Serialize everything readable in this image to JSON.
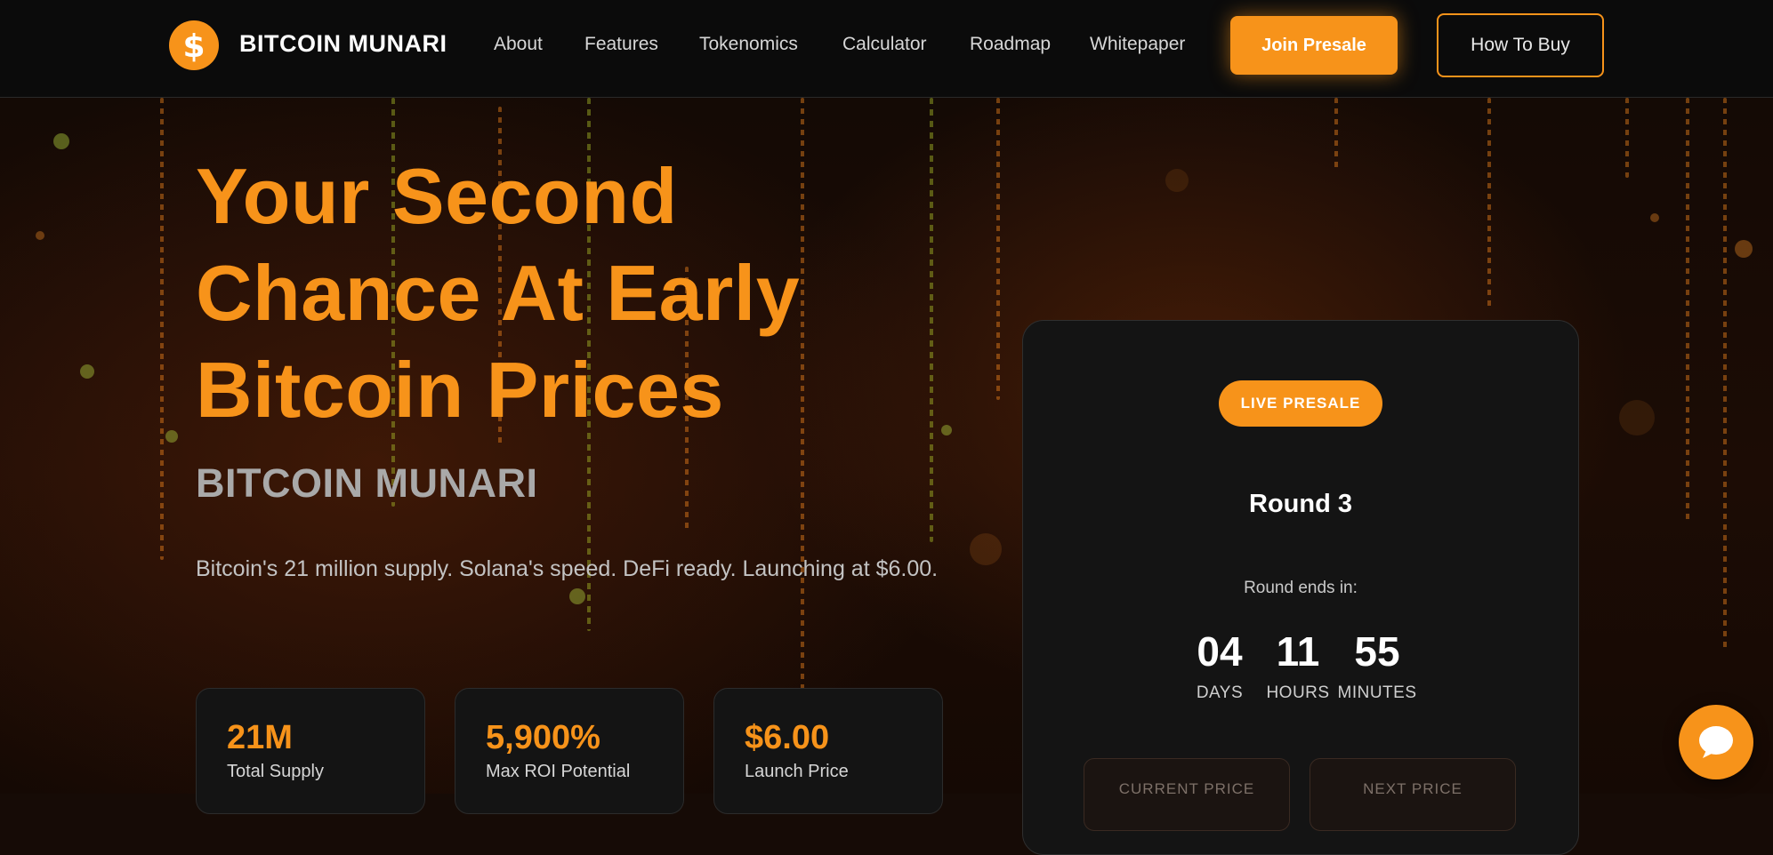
{
  "header": {
    "brand": "BITCOIN MUNARI",
    "logo_icon": "dollar-coin-icon",
    "nav": [
      "About",
      "Features",
      "Tokenomics",
      "Calculator",
      "Roadmap",
      "Whitepaper"
    ],
    "join_label": "Join Presale",
    "how_label": "How To Buy"
  },
  "hero": {
    "title_lines": [
      "Your Second",
      "Chance At Early",
      "Bitcoin Prices"
    ],
    "subtitle": "BITCOIN MUNARI",
    "description": "Bitcoin's 21 million supply. Solana's speed. DeFi ready. Launching at $6.00.",
    "stats": [
      {
        "value": "21M",
        "label": "Total Supply"
      },
      {
        "value": "5,900%",
        "label": "Max ROI Potential"
      },
      {
        "value": "$6.00",
        "label": "Launch Price"
      }
    ]
  },
  "presale": {
    "badge": "LIVE PRESALE",
    "round": "Round 3",
    "ends_label": "Round ends in:",
    "countdown": [
      {
        "value": "04",
        "unit": "DAYS"
      },
      {
        "value": "11",
        "unit": "HOURS"
      },
      {
        "value": "55",
        "unit": "MINUTES"
      }
    ],
    "current_price_label": "CURRENT PRICE",
    "next_price_label": "NEXT PRICE"
  },
  "chat": {
    "icon": "chat-bubble-icon"
  },
  "colors": {
    "accent": "#f7931a",
    "background": "#160b06",
    "card": "#141414"
  }
}
